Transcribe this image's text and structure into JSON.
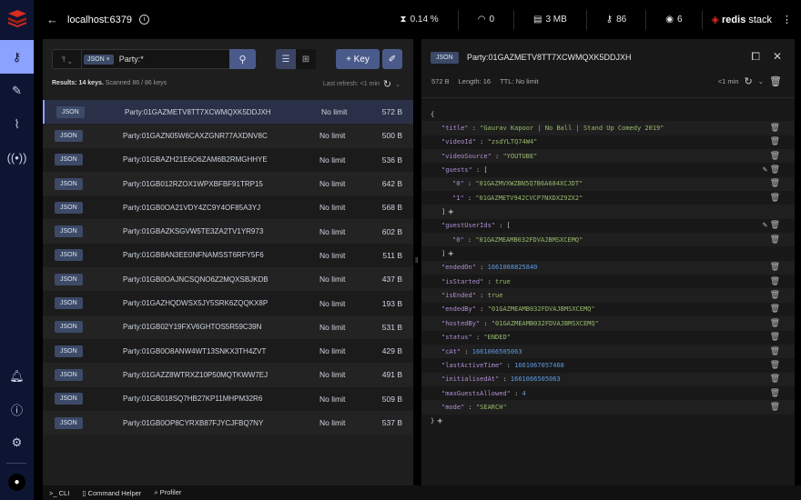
{
  "colors": {
    "accent": "#8ba2ff",
    "sidebar": "#0d1533",
    "button": "#4a5a8a",
    "json_key": "#b08fd6",
    "json_string": "#98b96b",
    "json_number": "#5c9be0"
  },
  "sidebar": {
    "items": [
      {
        "icon": "key-icon",
        "active": true
      },
      {
        "icon": "workbench-icon"
      },
      {
        "icon": "analytics-icon"
      },
      {
        "icon": "pubsub-icon"
      }
    ],
    "bottom": [
      {
        "icon": "bell-icon"
      },
      {
        "icon": "help-icon"
      },
      {
        "icon": "gear-icon"
      },
      {
        "icon": "github-icon"
      }
    ]
  },
  "header": {
    "host": "localhost:6379",
    "stats": {
      "cpu": "0.14 %",
      "ops": "0",
      "memory": "3 MB",
      "keys": "86",
      "clients": "6"
    },
    "brand_bold": "redis",
    "brand_rest": "stack"
  },
  "browser": {
    "filter_chip": "JSON",
    "query": "Party:*",
    "add_key": "+ Key",
    "results_bold": "Results: 14 keys.",
    "results_rest": " Scanned 86 / 86 keys",
    "last_refresh": "Last refresh: <1 min",
    "keys": [
      {
        "type": "JSON",
        "name": "Party:01GAZMETV8TT7XCWMQXK5DDJXH",
        "ttl": "No limit",
        "size": "572 B"
      },
      {
        "type": "JSON",
        "name": "Party:01GAZN05W6CAXZGNR77AXDNV8C",
        "ttl": "No limit",
        "size": "500 B"
      },
      {
        "type": "JSON",
        "name": "Party:01GBAZH21E6O6ZAM6B2RMGHHYE",
        "ttl": "No limit",
        "size": "536 B"
      },
      {
        "type": "JSON",
        "name": "Party:01GB012RZOX1WPXBFBF91TRP15",
        "ttl": "No limit",
        "size": "642 B"
      },
      {
        "type": "JSON",
        "name": "Party:01GB0OA21VDY4ZC9Y4OF85A3YJ",
        "ttl": "No limit",
        "size": "568 B"
      },
      {
        "type": "JSON",
        "name": "Party:01GBAZKSGVW5TE3ZA2TV1YR973",
        "ttl": "No limit",
        "size": "602 B"
      },
      {
        "type": "JSON",
        "name": "Party:01GB8AN3EE0NFNAMSST6RFY5F6",
        "ttl": "No limit",
        "size": "511 B"
      },
      {
        "type": "JSON",
        "name": "Party:01GB0OAJNCSQNO6Z2MQXSBJKDB",
        "ttl": "No limit",
        "size": "437 B"
      },
      {
        "type": "JSON",
        "name": "Party:01GAZHQDWSX5JY5SRK6ZQQKX8P",
        "ttl": "No limit",
        "size": "193 B"
      },
      {
        "type": "JSON",
        "name": "Party:01GB02Y19FXV6GHTOS5R59C39N",
        "ttl": "No limit",
        "size": "531 B"
      },
      {
        "type": "JSON",
        "name": "Party:01GB0O8ANW4WT13SNKX3TH4ZVT",
        "ttl": "No limit",
        "size": "429 B"
      },
      {
        "type": "JSON",
        "name": "Party:01GAZZ8WTRXZ10P50MQTKWW7EJ",
        "ttl": "No limit",
        "size": "491 B"
      },
      {
        "type": "JSON",
        "name": "Party:01GB018SQ7HB27KP11MHPM32R6",
        "ttl": "No limit",
        "size": "509 B"
      },
      {
        "type": "JSON",
        "name": "Party:01GB0OP8CYRXB87FJYCJFBQ7NY",
        "ttl": "No limit",
        "size": "537 B"
      }
    ]
  },
  "details": {
    "type": "JSON",
    "key": "Party:01GAZMETV8TT7XCWMQXK5DDJXH",
    "size": "572 B",
    "length": "Length: 16",
    "ttl_label": "TTL:",
    "ttl": "No limit",
    "refresh": "<1 min",
    "lines": [
      {
        "d": 0,
        "p": "{"
      },
      {
        "d": 1,
        "k": "title",
        "v": "\"Gaurav Kapoor | No Ball | Stand Up Comedy 2019\"",
        "t": "s",
        "del": true
      },
      {
        "d": 1,
        "k": "videoId",
        "v": "\"zsdYLTQ74W4\"",
        "t": "s",
        "del": true
      },
      {
        "d": 1,
        "k": "videoSource",
        "v": "\"YOUTUBE\"",
        "t": "s",
        "del": true
      },
      {
        "d": 1,
        "k": "guests",
        "v": "[",
        "t": "p",
        "del": true,
        "edit": true
      },
      {
        "d": 2,
        "k": "0",
        "v": "\"01GAZMVXWZBN5Q7B6A684XCJDT\"",
        "t": "s",
        "del": true
      },
      {
        "d": 2,
        "k": "1",
        "v": "\"01GAZMETV942CVCP7NXDXZ9ZX2\"",
        "t": "s",
        "del": true
      },
      {
        "d": 1,
        "p": "]",
        "plus": true
      },
      {
        "d": 1,
        "k": "guestUserIds",
        "v": "[",
        "t": "p",
        "del": true,
        "edit": true
      },
      {
        "d": 2,
        "k": "0",
        "v": "\"01GAZMEAMB032FDVAJBMSXCEMQ\"",
        "t": "s",
        "del": true
      },
      {
        "d": 1,
        "p": "]",
        "plus": true
      },
      {
        "d": 1,
        "k": "endedOn",
        "v": "1661068825840",
        "t": "n",
        "del": true
      },
      {
        "d": 1,
        "k": "isStarted",
        "v": "true",
        "t": "b",
        "del": true
      },
      {
        "d": 1,
        "k": "isEnded",
        "v": "true",
        "t": "b",
        "del": true
      },
      {
        "d": 1,
        "k": "endedBy",
        "v": "\"01GAZMEAMB032FDVAJBMSXCEMQ\"",
        "t": "s",
        "del": true
      },
      {
        "d": 1,
        "k": "hostedBy",
        "v": "\"01GAZMEAMB032FDVAJBMSXCEMQ\"",
        "t": "s",
        "del": true
      },
      {
        "d": 1,
        "k": "status",
        "v": "\"ENDED\"",
        "t": "s",
        "del": true
      },
      {
        "d": 1,
        "k": "cAt",
        "v": "1661066505063",
        "t": "n",
        "del": true
      },
      {
        "d": 1,
        "k": "lastActiveTime",
        "v": "1661067057468",
        "t": "n",
        "del": true
      },
      {
        "d": 1,
        "k": "initialisedAt",
        "v": "1661066505063",
        "t": "n",
        "del": true
      },
      {
        "d": 1,
        "k": "maxGuestsAllowed",
        "v": "4",
        "t": "n",
        "del": true
      },
      {
        "d": 1,
        "k": "mode",
        "v": "\"SEARCH\"",
        "t": "s",
        "del": true
      },
      {
        "d": 0,
        "p": "}",
        "plus": true
      }
    ]
  },
  "bottom": {
    "cli": "CLI",
    "helper": "Command Helper",
    "profiler": "Profiler"
  }
}
